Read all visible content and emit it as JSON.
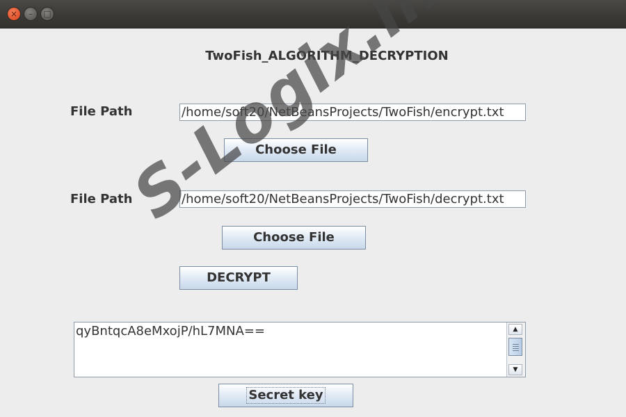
{
  "window": {
    "controls": {
      "close_glyph": "×",
      "minimize_glyph": "–",
      "maximize_glyph": "□"
    }
  },
  "heading": "TwoFish_ALGORITHM_DECRYPTION",
  "encrypt_file": {
    "label": "File Path",
    "value": "/home/soft20/NetBeansProjects/TwoFish/encrypt.txt",
    "button_label": "Choose File"
  },
  "decrypt_file": {
    "label": "File Path",
    "value": "/home/soft20/NetBeansProjects/TwoFish/decrypt.txt",
    "button_label": "Choose File"
  },
  "decrypt_button_label": "DECRYPT",
  "output": {
    "text": "qyBntqcA8eMxojP/hL7MNA==",
    "scroll_up_glyph": "▲",
    "scroll_down_glyph": "▼"
  },
  "secret_key_button_label": "Secret key",
  "watermark": "S-Logix.in"
}
